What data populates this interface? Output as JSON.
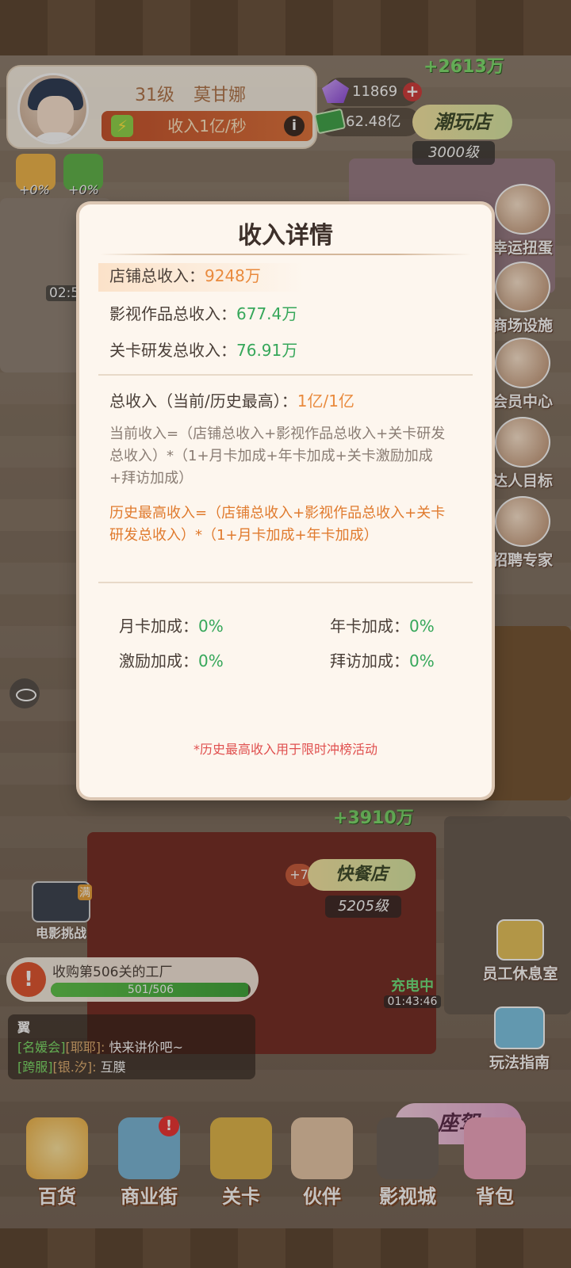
{
  "player": {
    "level_text": "31级",
    "name": "莫甘娜",
    "income_label": "收入1亿/秒"
  },
  "resources": {
    "gems": "11869",
    "cash": "62.48亿"
  },
  "shop": {
    "name": "潮玩店",
    "level": "3000级",
    "gain_top": "+2613万",
    "gain_mid": "+3910万"
  },
  "boosts": [
    "+0%",
    "+0%"
  ],
  "side_menu": [
    "幸运扭蛋",
    "商场设施",
    "会员中心",
    "达人目标",
    "招聘专家"
  ],
  "modal": {
    "title": "收入详情",
    "shop_income_label": "店铺总收入：",
    "shop_income_value": "9248万",
    "film_income_label": "影视作品总收入：",
    "film_income_value": "677.4万",
    "level_income_label": "关卡研发总收入：",
    "level_income_value": "76.91万",
    "total_label": "总收入（当前/历史最高）：",
    "total_value": "1亿/1亿",
    "current_formula": "当前收入=（店铺总收入+影视作品总收入+关卡研发总收入）*（1+月卡加成+年卡加成+关卡激励加成+拜访加成）",
    "history_formula": "历史最高收入=（店铺总收入+影视作品总收入+关卡研发总收入）*（1+月卡加成+年卡加成）",
    "monthly_label": "月卡加成：",
    "monthly_value": "0%",
    "yearly_label": "年卡加成：",
    "yearly_value": "0%",
    "incentive_label": "激励加成：",
    "incentive_value": "0%",
    "visit_label": "拜访加成：",
    "visit_value": "0%",
    "footnote": "*历史最高收入用于限时冲榜活动"
  },
  "timer": "02:5",
  "movie_challenge": "电影挑战",
  "movie_badge": "满",
  "kfc": {
    "plus": "+7",
    "name": "快餐店",
    "level": "5205级"
  },
  "charging": {
    "label": "充电中",
    "time": "01:43:46"
  },
  "quest": {
    "text": "收购第506关的工厂",
    "progress": "501/506",
    "progress_fraction": 0.99
  },
  "chat": {
    "header": "翼",
    "line1_channel": "[名媛会]",
    "line1_user": "[耶耶]:",
    "line1_msg": "快来讲价吧~",
    "line2_channel": "[跨服]",
    "line2_user": "[银.汐]:",
    "line2_msg": "互膜"
  },
  "right_extras": {
    "lounge": "员工休息室",
    "guide": "玩法指南",
    "drive": "座驾"
  },
  "nav": [
    {
      "label": "百货"
    },
    {
      "label": "商业街"
    },
    {
      "label": "关卡"
    },
    {
      "label": "伙伴"
    },
    {
      "label": "影视城"
    },
    {
      "label": "背包"
    }
  ],
  "colors": {
    "accent_orange": "#e98a3d",
    "accent_green": "#36a75a",
    "accent_red": "#e04d4d"
  }
}
